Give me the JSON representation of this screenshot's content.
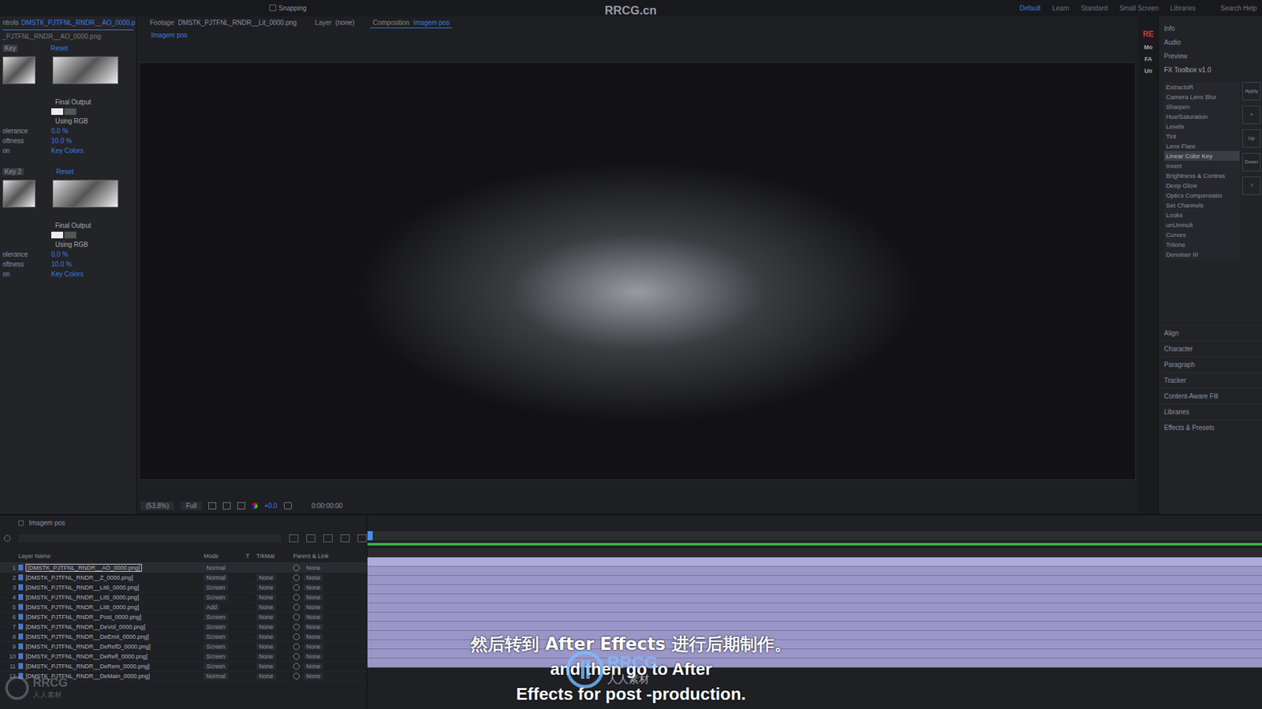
{
  "top_bar": {
    "snapping": "Snapping",
    "workspaces": [
      {
        "label": "Default",
        "selected": true
      },
      {
        "label": "Learn",
        "selected": false
      },
      {
        "label": "Standard",
        "selected": false
      },
      {
        "label": "Small Screen",
        "selected": false
      },
      {
        "label": "Libraries",
        "selected": false
      }
    ],
    "search": "Search Help"
  },
  "panel_tabs": [
    {
      "label": "ntrols",
      "file": "DMSTK_PJTFNL_RNDR__AO_0000.p",
      "selected": true
    },
    {
      "label": "Footage",
      "file": "DMSTK_PJTFNL_RNDR__Lit_0000.png",
      "selected": false
    },
    {
      "label": "Layer",
      "file": "(none)",
      "selected": false
    },
    {
      "label": "Composition",
      "file": "Imagem pos",
      "selected": true
    }
  ],
  "breadcrumb": "Imagem pos",
  "effect_controls": {
    "layer": "_PJTFNL_RNDR__AO_0000.png",
    "keys": [
      {
        "label": "Key",
        "reset": "Reset",
        "output": "Final Output",
        "space": "Using RGB",
        "rows": [
          {
            "label": "olerance",
            "value": "0.0 %"
          },
          {
            "label": "oftness",
            "value": "10.0 %"
          },
          {
            "label": "on",
            "value": "Key Colors"
          }
        ]
      },
      {
        "label": "Key 2",
        "reset": "Reset",
        "output": "Final Output",
        "space": "Using RGB",
        "rows": [
          {
            "label": "olerance",
            "value": "0.0 %"
          },
          {
            "label": "oftness",
            "value": "10.0 %"
          },
          {
            "label": "on",
            "value": "Key Colors"
          }
        ]
      }
    ]
  },
  "viewer": {
    "zoom": "(53.8%)",
    "resolution": "Full",
    "exposure": "+0.0",
    "timecode": "0:00:00:00"
  },
  "script_strip": [
    "RE",
    "Mo",
    "FA",
    "Un"
  ],
  "right_panel": {
    "top_panels": [
      "Info",
      "Audio",
      "Preview"
    ],
    "toolbox": {
      "title": "FX Toolbox v1.0",
      "effects": [
        {
          "label": "ExtractoR",
          "selected": false
        },
        {
          "label": "Camera Lens Blur",
          "selected": false
        },
        {
          "label": "Sharpen",
          "selected": false
        },
        {
          "label": "Hue/Saturation",
          "selected": false
        },
        {
          "label": "Levels",
          "selected": false
        },
        {
          "label": "Tint",
          "selected": false
        },
        {
          "label": "Lens Flare",
          "selected": false
        },
        {
          "label": "Linear Color Key",
          "selected": true
        },
        {
          "label": "Invert",
          "selected": false
        },
        {
          "label": "Brightness & Contras",
          "selected": false
        },
        {
          "label": "Deep Glow",
          "selected": false
        },
        {
          "label": "Optics Compensatio",
          "selected": false
        },
        {
          "label": "Set Channels",
          "selected": false
        },
        {
          "label": "Looks",
          "selected": false
        },
        {
          "label": "unUnmult",
          "selected": false
        },
        {
          "label": "Curves",
          "selected": false
        },
        {
          "label": "Tritone",
          "selected": false
        },
        {
          "label": "Denoiser III",
          "selected": false
        }
      ],
      "buttons": [
        "Apply",
        "+",
        "Up",
        "Down",
        "?"
      ]
    },
    "bottom_panels": [
      "Align",
      "Character",
      "Paragraph",
      "Tracker",
      "Content-Aware Fill",
      "Libraries",
      "Effects & Presets"
    ]
  },
  "timeline": {
    "tab": "Imagem pos",
    "columns": [
      "Layer Name",
      "Mode",
      "T",
      "TrkMat",
      "Parent & Link"
    ],
    "layers": [
      {
        "num": "1",
        "name": "[DMSTK_PJTFNL_RNDR__AO_0000.png]",
        "mode": "Normal",
        "trkmat": "",
        "parent": "None",
        "selected": true
      },
      {
        "num": "2",
        "name": "[DMSTK_PJTFNL_RNDR__Z_0000.png]",
        "mode": "Normal",
        "trkmat": "None",
        "parent": "None",
        "selected": false
      },
      {
        "num": "3",
        "name": "[DMSTK_PJTFNL_RNDR__Lit6_0000.png]",
        "mode": "Screen",
        "trkmat": "None",
        "parent": "None",
        "selected": false
      },
      {
        "num": "4",
        "name": "[DMSTK_PJTFNL_RNDR__Lit5_0000.png]",
        "mode": "Screen",
        "trkmat": "None",
        "parent": "None",
        "selected": false
      },
      {
        "num": "5",
        "name": "[DMSTK_PJTFNL_RNDR__Lit8_0000.png]",
        "mode": "Add",
        "trkmat": "None",
        "parent": "None",
        "selected": false
      },
      {
        "num": "6",
        "name": "[DMSTK_PJTFNL_RNDR__Post_0000.png]",
        "mode": "Screen",
        "trkmat": "None",
        "parent": "None",
        "selected": false
      },
      {
        "num": "7",
        "name": "[DMSTK_PJTFNL_RNDR__DeVol_0000.png]",
        "mode": "Screen",
        "trkmat": "None",
        "parent": "None",
        "selected": false
      },
      {
        "num": "8",
        "name": "[DMSTK_PJTFNL_RNDR__DeEmit_0000.png]",
        "mode": "Screen",
        "trkmat": "None",
        "parent": "None",
        "selected": false
      },
      {
        "num": "9",
        "name": "[DMSTK_PJTFNL_RNDR__DeRefD_0000.png]",
        "mode": "Screen",
        "trkmat": "None",
        "parent": "None",
        "selected": false
      },
      {
        "num": "10",
        "name": "[DMSTK_PJTFNL_RNDR__DeRefl_0000.png]",
        "mode": "Screen",
        "trkmat": "None",
        "parent": "None",
        "selected": false
      },
      {
        "num": "11",
        "name": "[DMSTK_PJTFNL_RNDR__DeRem_0000.png]",
        "mode": "Screen",
        "trkmat": "None",
        "parent": "None",
        "selected": false
      },
      {
        "num": "12",
        "name": "[DMSTK_PJTFNL_RNDR__DeMain_0000.png]",
        "mode": "Normal",
        "trkmat": "None",
        "parent": "None",
        "selected": false
      }
    ]
  },
  "subtitles": {
    "zh": "然后转到 After Effects 进行后期制作。",
    "en": [
      "and then go to After",
      "Effects for post -production."
    ]
  },
  "watermark": {
    "top": "RRCG.cn",
    "logo": "RRCG",
    "logo_sub": "人人素材"
  }
}
